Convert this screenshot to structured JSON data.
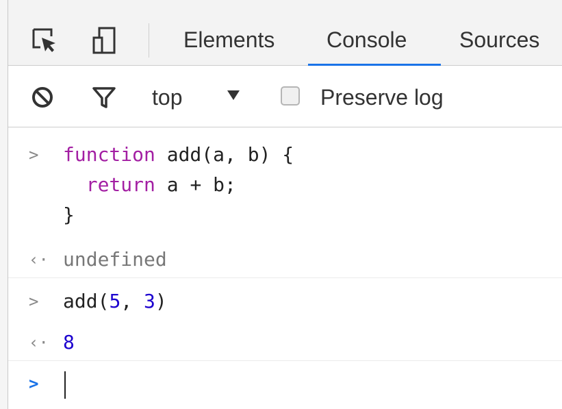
{
  "tabs": [
    {
      "label": "Elements"
    },
    {
      "label": "Console",
      "active": true
    },
    {
      "label": "Sources"
    }
  ],
  "toolbar": {
    "context": "top",
    "preserve_log": "Preserve log",
    "preserve_checked": false
  },
  "console": {
    "entry1": {
      "line1_kw": "function",
      "line1_rest": " add(a, b) {",
      "line2_indent": "  ",
      "line2_kw": "return",
      "line2_rest": " a + b;",
      "line3": "}"
    },
    "result1": "undefined",
    "entry2": {
      "prefix": "add(",
      "arg1": "5",
      "mid": ", ",
      "arg2": "3",
      "suffix": ")"
    },
    "result2": "8"
  },
  "icons": {
    "inspect": "inspect-element-icon",
    "device": "device-toolbar-icon",
    "clear": "clear-console-icon",
    "filter": "filter-icon",
    "input_prompt": "chevron-right-icon",
    "output_prompt": "output-arrow-icon"
  },
  "colors": {
    "accent": "#1a73e8",
    "keyword": "#a31fa3",
    "number": "#1c00cf"
  }
}
